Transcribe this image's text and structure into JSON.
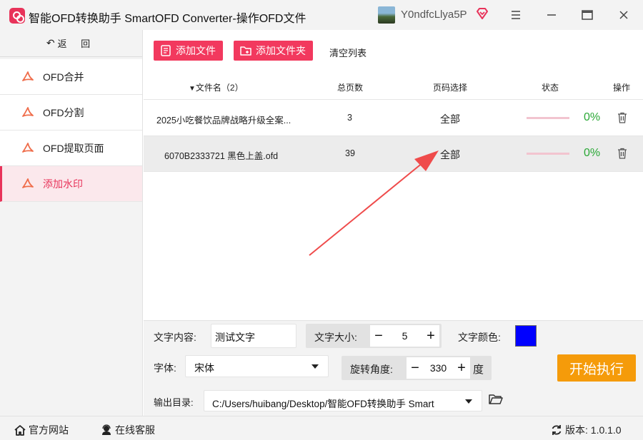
{
  "window": {
    "title": "智能OFD转换助手 SmartOFD Converter-操作OFD文件",
    "username": "Y0ndfcLlya5P",
    "controls": [
      "menu-icon",
      "minimize-icon",
      "maximize-icon",
      "close-icon"
    ]
  },
  "sidebar": {
    "back_label": "返 回",
    "items": [
      {
        "label": "OFD合并",
        "icon": "pdf-icon",
        "active": false
      },
      {
        "label": "OFD分割",
        "icon": "pdf-icon",
        "active": false
      },
      {
        "label": "OFD提取页面",
        "icon": "pdf-icon",
        "active": false
      },
      {
        "label": "添加水印",
        "icon": "pdf-icon",
        "active": true
      }
    ]
  },
  "toolbar": {
    "add_file": "添加文件",
    "add_folder": "添加文件夹",
    "clear_list": "清空列表"
  },
  "table": {
    "headers": {
      "name": "文件名（2）",
      "pages": "总页数",
      "range": "页码选择",
      "status": "状态",
      "action": "操作"
    },
    "rows": [
      {
        "name": "2025小吃餐饮品牌战略升级全案...",
        "pages": "3",
        "range": "全部",
        "progress": 0,
        "percent": "0%"
      },
      {
        "name": "6070B2333721 黑色上盖.ofd",
        "pages": "39",
        "range": "全部",
        "progress": 0,
        "percent": "0%"
      }
    ]
  },
  "settings": {
    "text_content_label": "文字内容:",
    "text_content_value": "测试文字",
    "font_size_label": "文字大小:",
    "font_size_value": "5",
    "font_color_label": "文字颜色:",
    "font_color": "#0000ff",
    "font_label": "字体:",
    "font_value": "宋体",
    "rotation_label": "旋转角度:",
    "rotation_value": "330",
    "rotation_unit": "度",
    "output_label": "输出目录:",
    "output_value": "C:/Users/huibang/Desktop/智能OFD转换助手 Smart",
    "start_button": "开始执行"
  },
  "statusbar": {
    "website": "官方网站",
    "support": "在线客服",
    "version": "版本: 1.0.1.0"
  },
  "colors": {
    "accent": "#f2395e",
    "start": "#f59b0a",
    "success": "#2aa836"
  }
}
